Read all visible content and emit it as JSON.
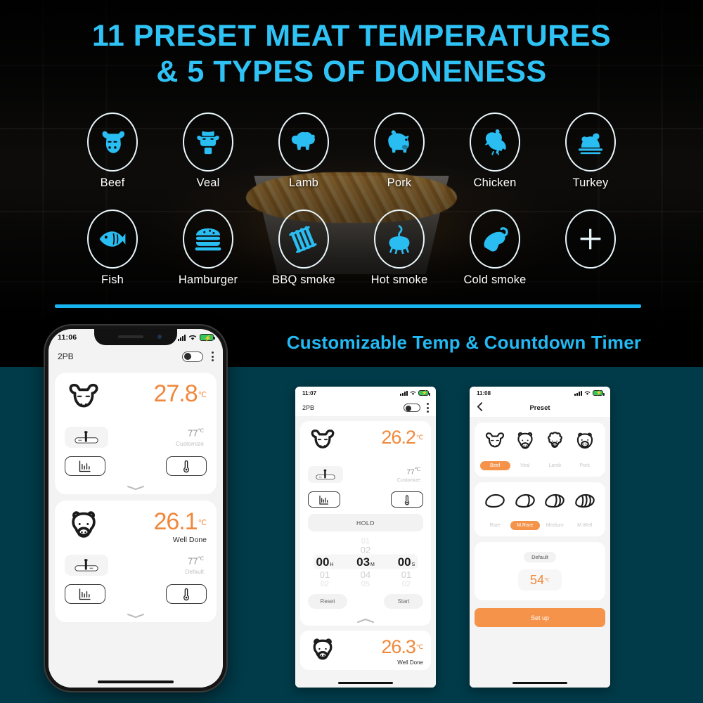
{
  "hero": {
    "headline_line1": "11 PRESET MEAT TEMPERATURES",
    "headline_line2": "& 5 TYPES OF DONENESS",
    "subtitle": "Customizable Temp & Countdown Timer",
    "accent_cyan": "#29bdf2",
    "divider_color": "#16b4f0",
    "background_color": "#060606",
    "presets_row1": [
      {
        "label": "Beef",
        "icon": "beef-head-icon"
      },
      {
        "label": "Veal",
        "icon": "veal-head-icon"
      },
      {
        "label": "Lamb",
        "icon": "lamb-icon"
      },
      {
        "label": "Pork",
        "icon": "pig-icon"
      },
      {
        "label": "Chicken",
        "icon": "chicken-icon"
      },
      {
        "label": "Turkey",
        "icon": "turkey-icon"
      }
    ],
    "presets_row2": [
      {
        "label": "Fish",
        "icon": "fish-icon"
      },
      {
        "label": "Hamburger",
        "icon": "hamburger-icon"
      },
      {
        "label": "BBQ smoke",
        "icon": "bbq-ribs-icon"
      },
      {
        "label": "Hot smoke",
        "icon": "hot-smoke-icon"
      },
      {
        "label": "Cold smoke",
        "icon": "drumstick-icon"
      },
      {
        "label": "",
        "icon": "plus-icon"
      }
    ]
  },
  "page_bg": "#013a48",
  "app": {
    "accent_orange": "#f0883c",
    "title": "2PB",
    "probe_icon": "probe-thermometer-icon",
    "chart_icon": "chart-icon",
    "thermometer_icon": "thermometer-icon",
    "collapse_icon": "chevron-collapse-icon"
  },
  "phone1": {
    "status": {
      "time": "11:06",
      "signal": "signal-bars-icon",
      "wifi": "wifi-icon",
      "battery": "battery-charging-icon"
    },
    "appbar": {
      "title": "2PB",
      "toggle": "power-toggle",
      "menu": "kebab-menu-icon"
    },
    "cards": [
      {
        "meat_icon": "cow-horned-head-icon",
        "temp": "27.8",
        "unit": "℃",
        "state": "",
        "set_temp": "77",
        "set_unit": "℃",
        "set_label": "Customize"
      },
      {
        "meat_icon": "cow-round-head-icon",
        "temp": "26.1",
        "unit": "℃",
        "state": "Well Done",
        "set_temp": "77",
        "set_unit": "℃",
        "set_label": "Default"
      }
    ]
  },
  "phone2": {
    "status": {
      "time": "11:07",
      "signal": "signal-bars-icon",
      "wifi": "wifi-icon",
      "battery": "battery-charging-icon"
    },
    "appbar": {
      "title": "2PB",
      "toggle": "power-toggle",
      "menu": "kebab-menu-icon"
    },
    "card": {
      "meat_icon": "cow-horned-head-icon",
      "temp": "26.2",
      "unit": "℃",
      "set_temp": "77",
      "set_unit": "℃",
      "set_label": "Customize"
    },
    "timer": {
      "hold_label": "HOLD",
      "columns": [
        {
          "above2": "",
          "above": "",
          "value": "00",
          "unit": "H",
          "below": "01",
          "below2": "02"
        },
        {
          "above2": "01",
          "above": "02",
          "value": "03",
          "unit": "M",
          "below": "04",
          "below2": "05"
        },
        {
          "above2": "",
          "above": "",
          "value": "00",
          "unit": "S",
          "below": "01",
          "below2": "02"
        }
      ],
      "reset_label": "Reset",
      "start_label": "Start"
    },
    "card2": {
      "meat_icon": "cow-round-head-icon",
      "temp": "26.3",
      "unit": "℃",
      "state": "Well Done"
    }
  },
  "phone3": {
    "status": {
      "time": "11:08",
      "signal": "signal-bars-icon",
      "wifi": "wifi-icon",
      "battery": "battery-charging-icon"
    },
    "navbar": {
      "back": "back-chevron-icon",
      "title": "Preset"
    },
    "meats": [
      {
        "label": "Beef",
        "icon": "cow-horned-head-icon",
        "selected": true
      },
      {
        "label": "Veal",
        "icon": "cow-round-head-icon",
        "selected": false
      },
      {
        "label": "Lamb",
        "icon": "sheep-head-icon",
        "selected": false
      },
      {
        "label": "Pork",
        "icon": "pig-head-icon",
        "selected": false
      }
    ],
    "doneness": [
      {
        "label": "Rare",
        "icon": "steak-rare-icon",
        "selected": false
      },
      {
        "label": "M.Rare",
        "icon": "steak-medium-rare-icon",
        "selected": true
      },
      {
        "label": "Medium",
        "icon": "steak-medium-icon",
        "selected": false
      },
      {
        "label": "M.Well",
        "icon": "steak-medium-well-icon",
        "selected": false
      }
    ],
    "default_chip": "Default",
    "temp_value": "54",
    "temp_unit": "℃",
    "setup_label": "Set up"
  }
}
